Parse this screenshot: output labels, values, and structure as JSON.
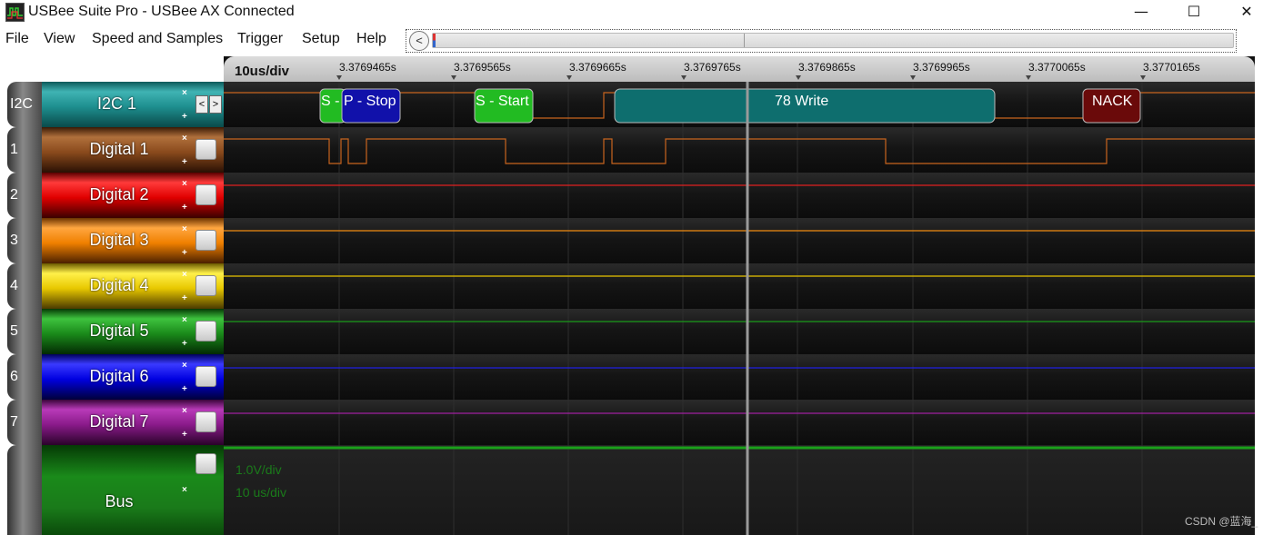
{
  "window": {
    "title": "USBee Suite Pro - USBee AX Connected",
    "minimize": "—",
    "maximize": "☐",
    "close": "✕"
  },
  "menu": [
    "File",
    "View",
    "Speed and Samples",
    "Trigger",
    "Setup",
    "Help"
  ],
  "nav": {
    "back": "<<<",
    "forward": ">>>",
    "scroll_left": "<"
  },
  "timebase": {
    "div_label": "10us/div",
    "ticks": [
      "3.3769465s",
      "3.3769565s",
      "3.3769665s",
      "3.3769765s",
      "3.3769865s",
      "3.3769965s",
      "3.3770065s",
      "3.3770165s"
    ]
  },
  "channels": [
    {
      "index": "I2C",
      "name": "I2C 1",
      "color": "#1e8f8f",
      "type": "i2c"
    },
    {
      "index": "1",
      "name": "Digital 1",
      "color": "#8a4a1c",
      "trace": "#c8641e"
    },
    {
      "index": "2",
      "name": "Digital 2",
      "color": "#e00000",
      "trace": "#e02020"
    },
    {
      "index": "3",
      "name": "Digital 3",
      "color": "#f08000",
      "trace": "#f08a10"
    },
    {
      "index": "4",
      "name": "Digital 4",
      "color": "#e8c800",
      "trace": "#e8c400"
    },
    {
      "index": "5",
      "name": "Digital 5",
      "color": "#1a8a1a",
      "trace": "#1a9a1a"
    },
    {
      "index": "6",
      "name": "Digital 6",
      "color": "#0000e0",
      "trace": "#2020e0"
    },
    {
      "index": "7",
      "name": "Digital 7",
      "color": "#8a1a8a",
      "trace": "#a020a0"
    },
    {
      "index": "",
      "name": "Bus",
      "color": "#1a7a1a",
      "type": "bus"
    }
  ],
  "channel_buttons": {
    "remove": "×",
    "add": "+",
    "prev": "<",
    "next": ">"
  },
  "decode": [
    {
      "label": "S -",
      "color": "#22bb22"
    },
    {
      "label": "P - Stop",
      "color": "#1111aa"
    },
    {
      "label": "S - Start",
      "color": "#22bb22"
    },
    {
      "label": "78 Write",
      "color": "#0e6e6e"
    },
    {
      "label": "NACK",
      "color": "#6a0a0a"
    }
  ],
  "bus": {
    "volt_div": "1.0V/div",
    "time_div": "10 us/div"
  },
  "watermark": "CSDN @蓝海_"
}
